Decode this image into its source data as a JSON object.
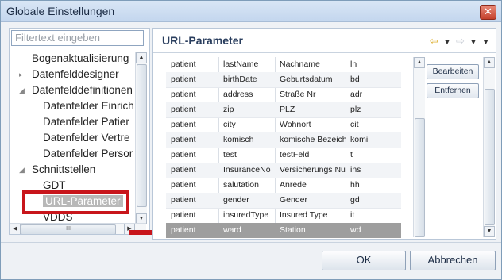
{
  "window": {
    "title": "Globale Einstellungen",
    "close_glyph": "✕"
  },
  "filter": {
    "placeholder": "Filtertext eingeben"
  },
  "tree": {
    "items": [
      {
        "label": "Bogenaktualisierung",
        "indent": 0
      },
      {
        "label": "Datenfelddesigner",
        "indent": 0,
        "arrow": "▸"
      },
      {
        "label": "Datenfelddefinitionen",
        "indent": 0,
        "arrow": "◢"
      },
      {
        "label": "Datenfelder Einrich",
        "indent": 1
      },
      {
        "label": "Datenfelder Patier",
        "indent": 1
      },
      {
        "label": "Datenfelder Vertre",
        "indent": 1
      },
      {
        "label": "Datenfelder Persor",
        "indent": 1
      },
      {
        "label": "Schnittstellen",
        "indent": 0,
        "arrow": "◢"
      },
      {
        "label": "GDT",
        "indent": 1
      },
      {
        "label": "URL-Parameter",
        "indent": 1,
        "selected": true
      },
      {
        "label": "VDDS",
        "indent": 1
      }
    ]
  },
  "right": {
    "title": "URL-Parameter",
    "nav_icons": [
      "arrow-left-icon",
      "dropdown-icon",
      "arrow-right-icon",
      "dropdown-icon",
      "dropdown-icon"
    ],
    "rows": [
      [
        "patient",
        "lastName",
        "Nachname",
        "ln"
      ],
      [
        "patient",
        "birthDate",
        "Geburtsdatum",
        "bd"
      ],
      [
        "patient",
        "address",
        "Straße Nr",
        "adr"
      ],
      [
        "patient",
        "zip",
        "PLZ",
        "plz"
      ],
      [
        "patient",
        "city",
        "Wohnort",
        "cit"
      ],
      [
        "patient",
        "komisch",
        "komische Bezeichnung",
        "komi"
      ],
      [
        "patient",
        "test",
        "testFeld",
        "t"
      ],
      [
        "patient",
        "InsuranceNo",
        "Versicherungs Nummer",
        "ins"
      ],
      [
        "patient",
        "salutation",
        "Anrede",
        "hh"
      ],
      [
        "patient",
        "gender",
        "Gender",
        "gd"
      ],
      [
        "patient",
        "insuredType",
        "Insured Type",
        "it"
      ],
      [
        "patient",
        "ward",
        "Station",
        "wd"
      ]
    ],
    "selected_row": 11,
    "edit_label": "Bearbeiten",
    "remove_label": "Entfernen"
  },
  "footer": {
    "ok_label": "OK",
    "cancel_label": "Abbrechen"
  },
  "colors": {
    "highlight": "#c8151b",
    "selection": "#9e9e9e"
  }
}
